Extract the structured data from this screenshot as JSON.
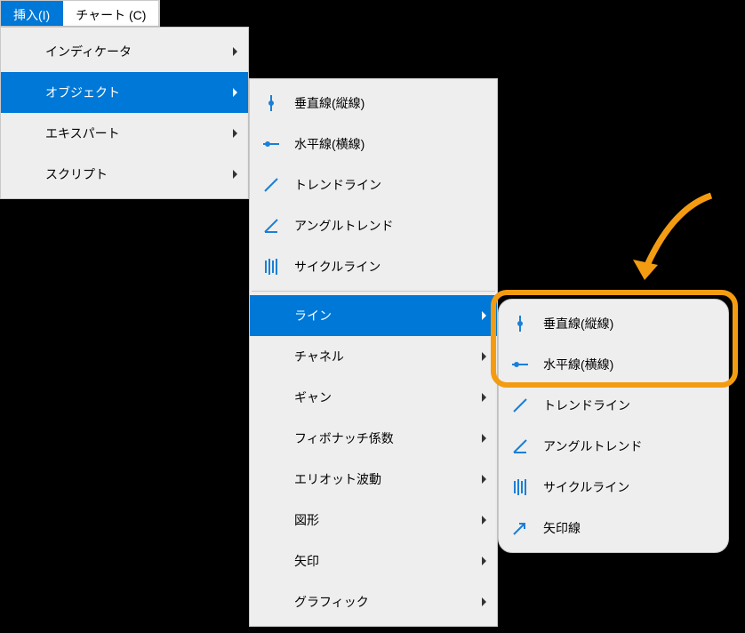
{
  "menubar": {
    "insert": "挿入(I)",
    "chart": "チャート (C)"
  },
  "menu1": {
    "indicator": "インディケータ",
    "object": "オブジェクト",
    "expert": "エキスパート",
    "script": "スクリプト"
  },
  "menu2": {
    "vertical": "垂直線(縦線)",
    "horizontal": "水平線(横線)",
    "trendline": "トレンドライン",
    "angletrend": "アングルトレンド",
    "cycleline": "サイクルライン",
    "line": "ライン",
    "channel": "チャネル",
    "gann": "ギャン",
    "fibonacci": "フィボナッチ係数",
    "elliott": "エリオット波動",
    "shape": "図形",
    "arrow": "矢印",
    "graphic": "グラフィック"
  },
  "menu3": {
    "vertical": "垂直線(縦線)",
    "horizontal": "水平線(横線)",
    "trendline": "トレンドライン",
    "angletrend": "アングルトレンド",
    "cycleline": "サイクルライン",
    "arrowline": "矢印線"
  }
}
